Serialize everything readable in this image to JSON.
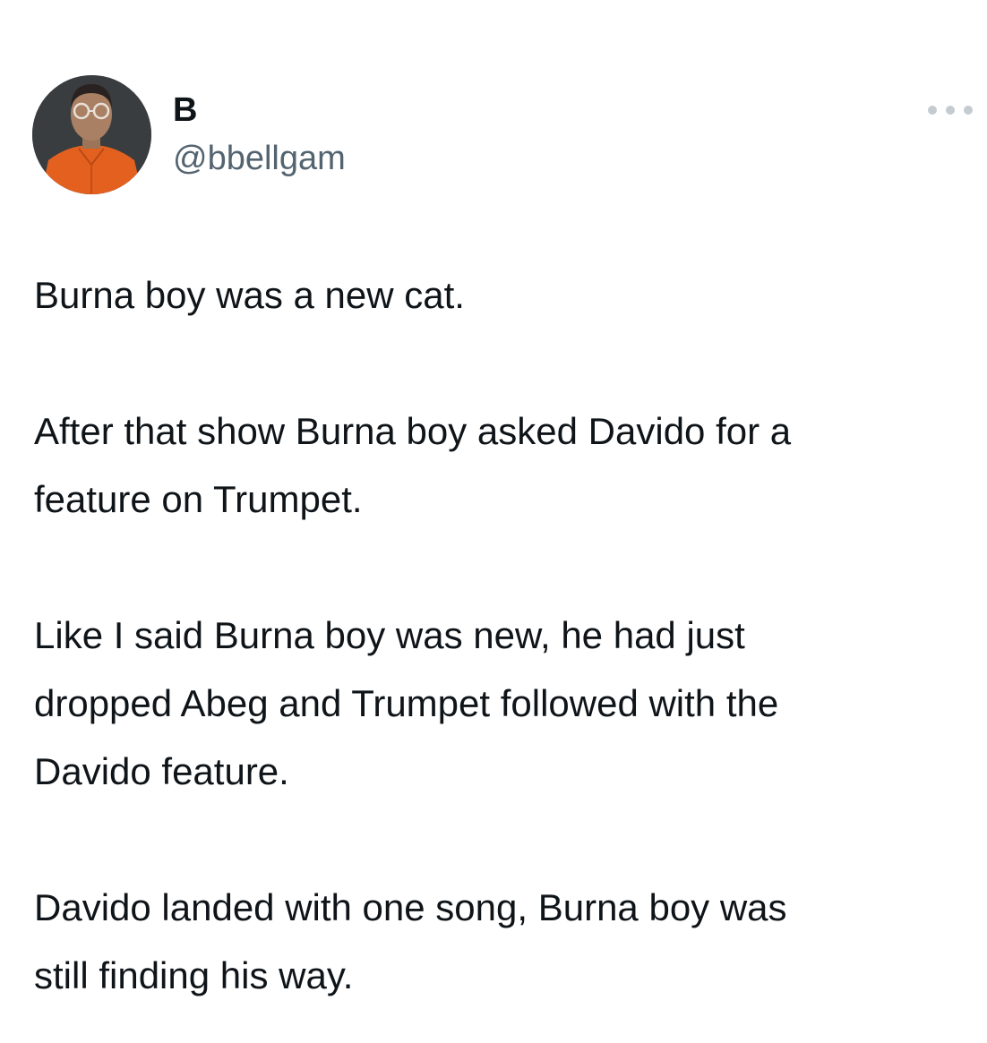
{
  "author": {
    "display_name": "B",
    "handle": "@bbellgam"
  },
  "icons": {
    "avatar": "profile-avatar",
    "more": "more-options-icon",
    "chevron": "chevron-down-icon"
  },
  "tweet": {
    "paragraphs": [
      "Burna boy was a new cat.",
      "After that show Burna boy asked Davido for a\nfeature on Trumpet.",
      "Like I said Burna boy was new, he had just\ndropped Abeg and Trumpet followed with the\nDavido feature.",
      "Davido landed with one song, Burna boy was\nstill finding his way."
    ]
  },
  "colors": {
    "text": "#0f1419",
    "secondary": "#536471",
    "avatar_shirt": "#e4601f"
  }
}
